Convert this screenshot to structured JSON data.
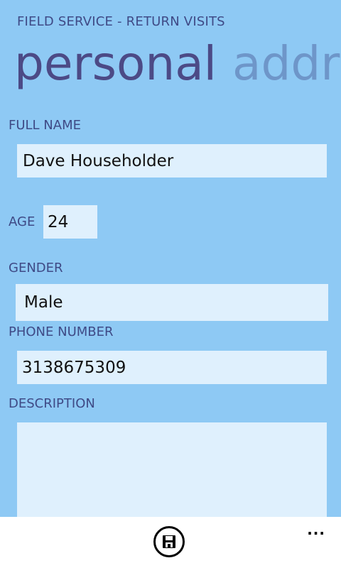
{
  "app": {
    "title": "FIELD SERVICE - RETURN VISITS"
  },
  "pivot": {
    "active": "personal",
    "next": "addre"
  },
  "form": {
    "full_name_label": "FULL NAME",
    "full_name_value": "Dave Householder",
    "age_label": "AGE",
    "age_value": "24",
    "gender_label": "GENDER",
    "gender_value": "Male",
    "phone_label": "PHONE NUMBER",
    "phone_value": "3138675309",
    "description_label": "DESCRIPTION",
    "description_value": ""
  },
  "appbar": {
    "save_icon": "save-icon",
    "more_label": "..."
  }
}
